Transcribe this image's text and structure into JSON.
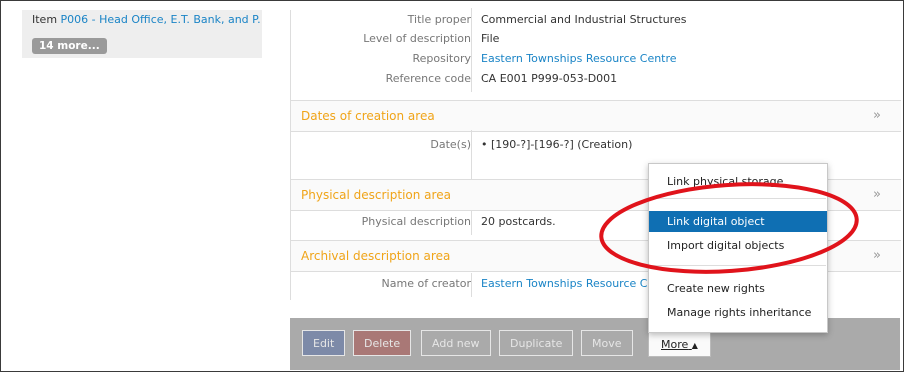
{
  "sidebar": {
    "item_prefix": "Item ",
    "item_link": "P006 - Head Office, E.T. Bank, and P...",
    "more_badge": "14 more..."
  },
  "fields": [
    {
      "label": "Title proper",
      "value": "Commercial and Industrial Structures"
    },
    {
      "label": "Level of description",
      "value": "File"
    },
    {
      "label": "Repository",
      "value": "Eastern Townships Resource Centre"
    },
    {
      "label": "Reference code",
      "value": "CA E001 P999-053-D001"
    }
  ],
  "areas": {
    "dates": {
      "title": "Dates of creation area",
      "label": "Date(s)",
      "value": "[190-?]-[196-?] (Creation)"
    },
    "physical": {
      "title": "Physical description area",
      "label": "Physical description",
      "value": "20 postcards."
    },
    "archival": {
      "title": "Archival description area",
      "label": "Name of creator",
      "value": "Eastern Townships Resource Ce"
    }
  },
  "chevron": "»",
  "bullet": "•",
  "actions": {
    "edit": "Edit",
    "delete": "Delete",
    "add_new": "Add new",
    "duplicate": "Duplicate",
    "move": "Move",
    "more": "More",
    "more_caret": "▲"
  },
  "menu": {
    "items": [
      "Link physical storage",
      "Link digital object",
      "Import digital objects",
      "Create new rights",
      "Manage rights inheritance"
    ],
    "active_index": 1
  },
  "colors": {
    "link": "#1a84c6",
    "area_title": "#f0a418",
    "menu_active": "#0f6fb3",
    "highlight_ellipse": "#e0131b"
  }
}
